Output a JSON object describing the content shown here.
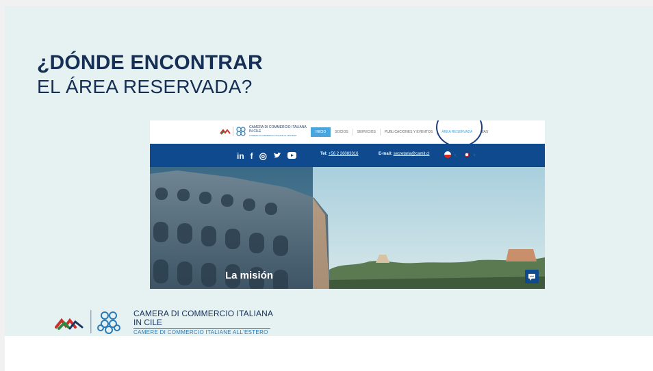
{
  "slide": {
    "title_line1": "¿DÓNDE ENCONTRAR",
    "title_line2": "EL ÁREA RESERVADA?"
  },
  "website": {
    "logo_title": "CAMERA DI COMMERCIO ITALIANA",
    "logo_subtitle": "IN CILE",
    "logo_tagline": "CAMERE DI COMMERCIO ITALIANE ALL'ESTERO",
    "nav": [
      {
        "label": "INICIO",
        "active": true
      },
      {
        "label": "SOCIOS"
      },
      {
        "label": "SERVICIOS"
      },
      {
        "label": "PUBLICACIONES Y EVENTOS"
      },
      {
        "label": "ÁREA RESERVADA"
      },
      {
        "label": "MAS"
      }
    ],
    "social_icons": [
      "linkedin-icon",
      "facebook-icon",
      "instagram-icon",
      "twitter-icon",
      "youtube-icon"
    ],
    "social_glyphs": [
      "in",
      "f",
      "◎",
      "🐦",
      "▶"
    ],
    "tel_label": "Tel:",
    "tel_value": "+56 2 26083316",
    "email_label": "E-mail:",
    "email_value": "secretaria@camit.cl",
    "hero_caption": "La misión",
    "colors": {
      "accent": "#4aa5dc",
      "bar": "#0e4a8d",
      "title": "#162f55"
    }
  },
  "footer": {
    "title": "CAMERA DI COMMERCIO ITALIANA",
    "subtitle": "IN CILE",
    "tagline": "CAMERE DI COMMERCIO ITALIANE ALL'ESTERO"
  }
}
